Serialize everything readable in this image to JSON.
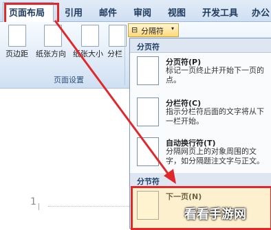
{
  "tabs": [
    "页面布局",
    "引用",
    "邮件",
    "审阅",
    "视图",
    "开发工具",
    "办公"
  ],
  "ribbon": {
    "buttons": [
      "页边距",
      "纸张方向",
      "纸张大小",
      "分栏"
    ],
    "group_label": "页面设置",
    "separator_button": "分隔符"
  },
  "menu": {
    "section1": "分页符",
    "items": [
      {
        "title": "分页符(P)",
        "desc": "标记一页终止并开始下一页的点。"
      },
      {
        "title": "分栏符(C)",
        "desc": "指示分栏符后面的文字将从下一栏开始。"
      },
      {
        "title": "自动换行符(T)",
        "desc": "分隔网页上的对象周围的文字，如分隔题注文字与正文。"
      }
    ],
    "section2": "分节符",
    "next_page": {
      "title": "下一页(N)"
    }
  },
  "doc": {
    "line_number": "1"
  },
  "watermark": "看看手游网",
  "colors": {
    "highlight": "#e0282a",
    "ribbon": "#dce8f6"
  }
}
